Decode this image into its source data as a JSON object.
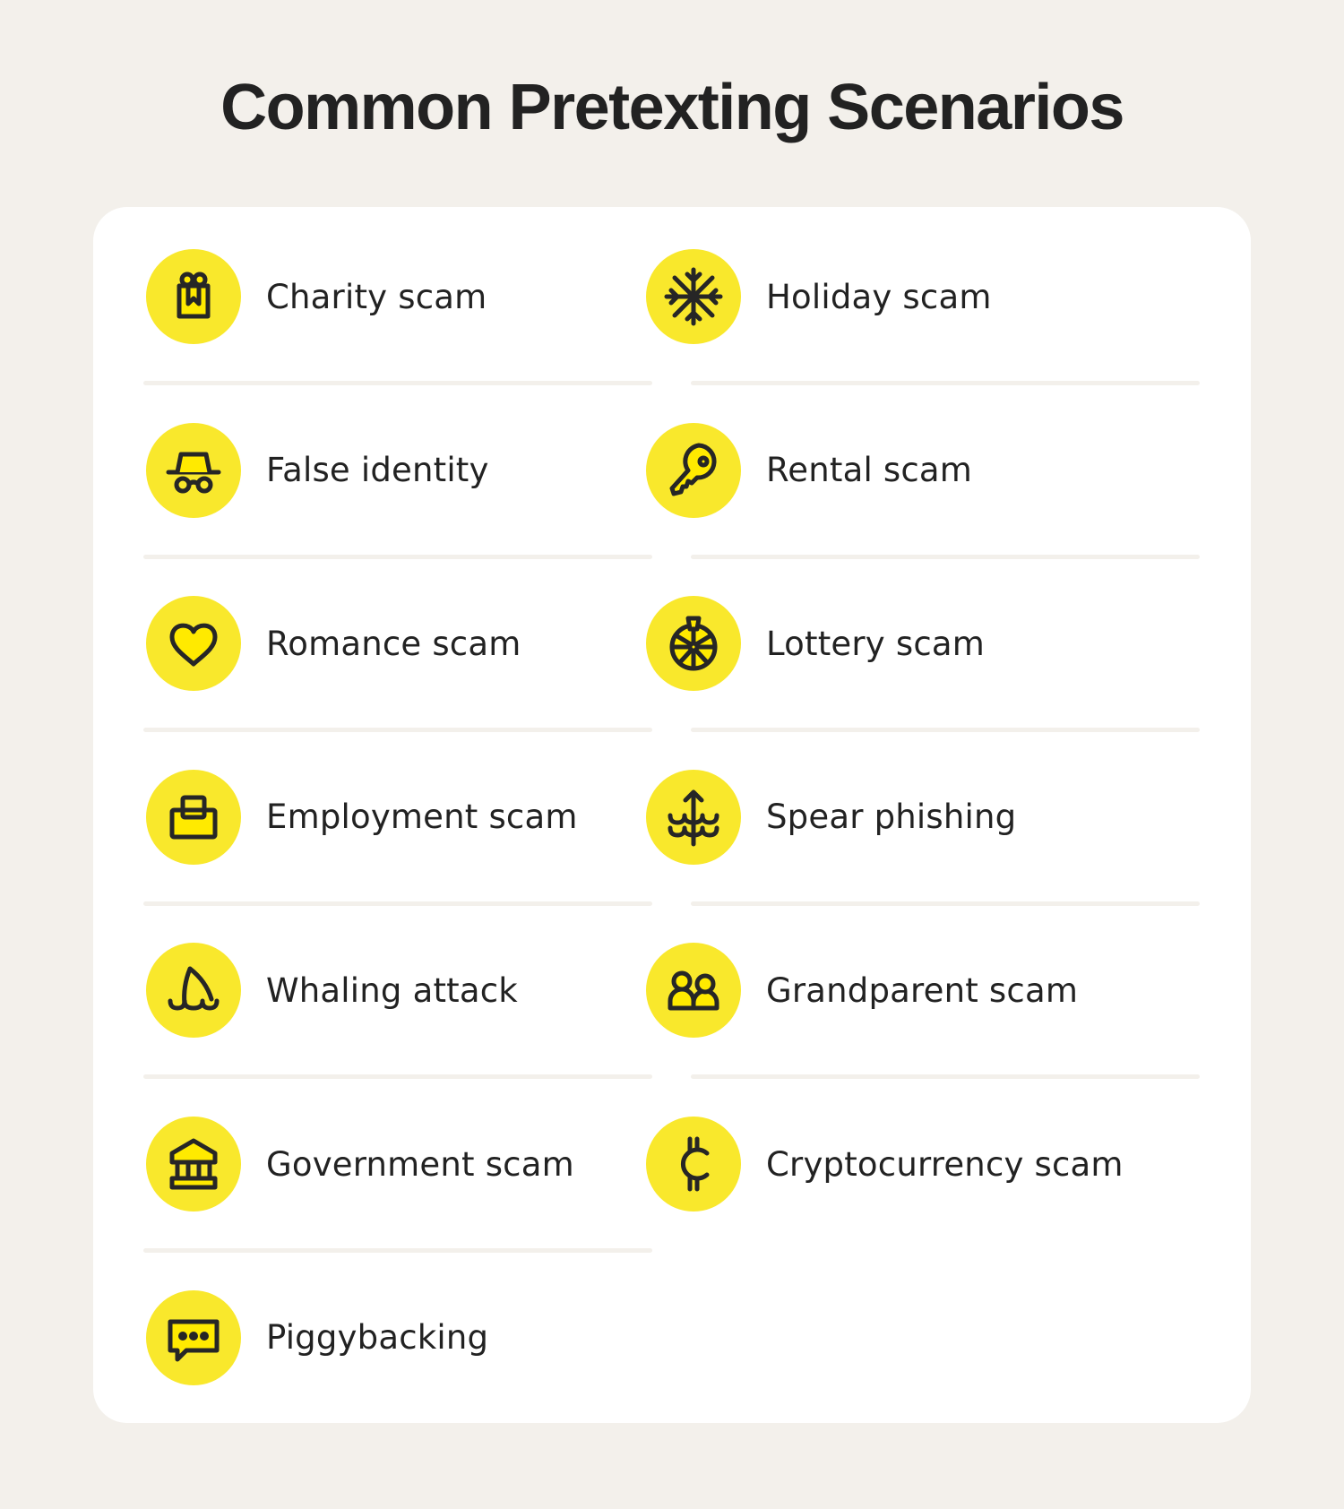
{
  "title": "Common Pretexting Scenarios",
  "colors": {
    "background": "#f3f0eb",
    "card": "#ffffff",
    "icon_circle": "#f9e82c",
    "icon_fill": "#ffea00",
    "icon_stroke": "#262626",
    "text": "#222222",
    "divider": "#f3f0eb"
  },
  "items": [
    {
      "label": "Charity scam",
      "icon": "gift-icon"
    },
    {
      "label": "Holiday scam",
      "icon": "snowflake-icon"
    },
    {
      "label": "False identity",
      "icon": "spy-hat-glasses-icon"
    },
    {
      "label": "Rental scam",
      "icon": "key-icon"
    },
    {
      "label": "Romance scam",
      "icon": "heart-icon"
    },
    {
      "label": "Lottery scam",
      "icon": "prize-wheel-icon"
    },
    {
      "label": "Employment scam",
      "icon": "briefcase-icon"
    },
    {
      "label": "Spear phishing",
      "icon": "spear-waves-icon"
    },
    {
      "label": "Whaling attack",
      "icon": "fin-waves-icon"
    },
    {
      "label": "Grandparent scam",
      "icon": "people-icon"
    },
    {
      "label": "Government scam",
      "icon": "government-building-icon"
    },
    {
      "label": "Cryptocurrency scam",
      "icon": "cent-coin-icon"
    },
    {
      "label": "Piggybacking",
      "icon": "chat-bubble-icon"
    }
  ]
}
